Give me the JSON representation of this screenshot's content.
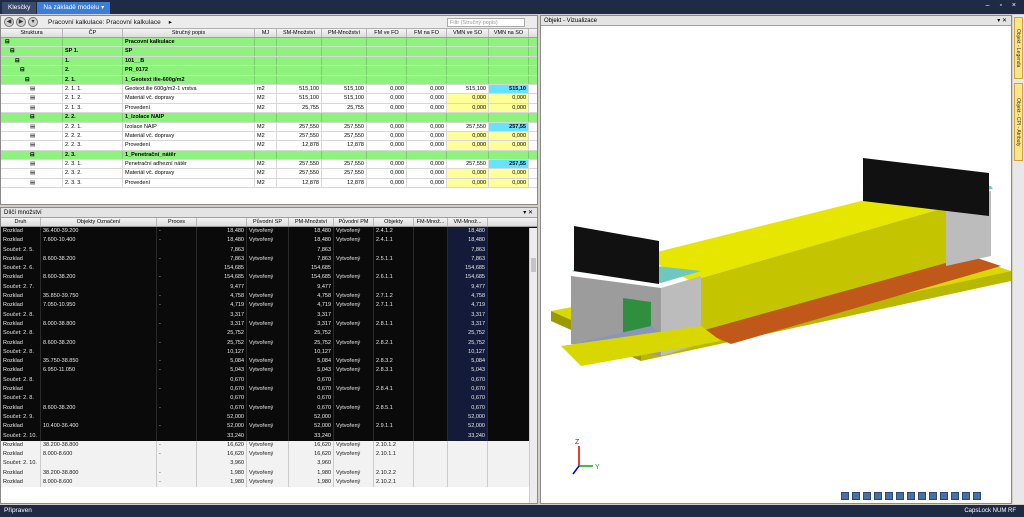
{
  "tabs": [
    {
      "label": "Klesčky"
    },
    {
      "label": "Na základě modelu"
    }
  ],
  "breadcrumb": "Pracovní kalkulace: Pracovní kalkulace",
  "filter_placeholder": "Filtr (Stručný popis)",
  "top_headers": [
    "Struktura",
    "ČP",
    "Stručný popis",
    "MJ",
    "SM-Množství",
    "PM-Množství",
    "FM ve FO",
    "FM na FO",
    "VMN ve SO",
    "VMN na SO"
  ],
  "top_rows": [
    {
      "cp": "",
      "desc": "Pracovní kalkulace",
      "mj": "",
      "sm": "",
      "pm": "",
      "fm1": "",
      "fm2": "",
      "v1": "",
      "v2": "",
      "g": true
    },
    {
      "cp": "SP  1.",
      "desc": "SP",
      "mj": "",
      "sm": "",
      "pm": "",
      "fm1": "",
      "fm2": "",
      "v1": "",
      "v2": "",
      "g": true
    },
    {
      "cp": "1.",
      "desc": "101__B",
      "mj": "",
      "sm": "",
      "pm": "",
      "fm1": "",
      "fm2": "",
      "v1": "",
      "v2": "",
      "g": true
    },
    {
      "cp": "2.",
      "desc": "PR_0172",
      "mj": "",
      "sm": "",
      "pm": "",
      "fm1": "",
      "fm2": "",
      "v1": "",
      "v2": "",
      "g": true
    },
    {
      "cp": "2.  1.",
      "desc": "1_Geotext ilie-600g/m2",
      "mj": "",
      "sm": "",
      "pm": "",
      "fm1": "",
      "fm2": "",
      "v1": "",
      "v2": "",
      "g": true
    },
    {
      "cp": "2.  1.  1.",
      "desc": "Geotext.ilie 600g/m2-1 vrstva",
      "mj": "m2",
      "sm": "515,100",
      "pm": "515,100",
      "fm1": "0,000",
      "fm2": "0,000",
      "v1": "515,100",
      "v2": "515,10"
    },
    {
      "cp": "2.  1.  2.",
      "desc": "Materiál vč. dopravy",
      "mj": "M2",
      "sm": "515,100",
      "pm": "515,100",
      "fm1": "0,000",
      "fm2": "0,000",
      "v1": "0,000",
      "v2": "0,000"
    },
    {
      "cp": "2.  1.  3.",
      "desc": "Provedení",
      "mj": "M2",
      "sm": "25,755",
      "pm": "25,755",
      "fm1": "0,000",
      "fm2": "0,000",
      "v1": "0,000",
      "v2": "0,000"
    },
    {
      "cp": "2.  2.",
      "desc": "1_Izolace NAIP",
      "mj": "",
      "sm": "",
      "pm": "",
      "fm1": "",
      "fm2": "",
      "v1": "",
      "v2": "",
      "g": true
    },
    {
      "cp": "2.  2.  1.",
      "desc": "Izolace NAIP",
      "mj": "M2",
      "sm": "257,550",
      "pm": "257,550",
      "fm1": "0,000",
      "fm2": "0,000",
      "v1": "257,550",
      "v2": "257,55"
    },
    {
      "cp": "2.  2.  2.",
      "desc": "Materiál vč. dopravy",
      "mj": "M2",
      "sm": "257,550",
      "pm": "257,550",
      "fm1": "0,000",
      "fm2": "0,000",
      "v1": "0,000",
      "v2": "0,000"
    },
    {
      "cp": "2.  2.  3.",
      "desc": "Provedení",
      "mj": "M2",
      "sm": "12,878",
      "pm": "12,878",
      "fm1": "0,000",
      "fm2": "0,000",
      "v1": "0,000",
      "v2": "0,000"
    },
    {
      "cp": "2.  3.",
      "desc": "1_Penetrační_nátěr",
      "mj": "",
      "sm": "",
      "pm": "",
      "fm1": "",
      "fm2": "",
      "v1": "",
      "v2": "",
      "g": true
    },
    {
      "cp": "2.  3.  1.",
      "desc": "Penetrační adhezní nátěr",
      "mj": "M2",
      "sm": "257,550",
      "pm": "257,550",
      "fm1": "0,000",
      "fm2": "0,000",
      "v1": "257,550",
      "v2": "257,55"
    },
    {
      "cp": "2.  3.  2.",
      "desc": "Materiál vč. dopravy",
      "mj": "M2",
      "sm": "257,550",
      "pm": "257,550",
      "fm1": "0,000",
      "fm2": "0,000",
      "v1": "0,000",
      "v2": "0,000"
    },
    {
      "cp": "2.  3.  3.",
      "desc": "Provedení",
      "mj": "M2",
      "sm": "12,878",
      "pm": "12,878",
      "fm1": "0,000",
      "fm2": "0,000",
      "v1": "0,000",
      "v2": "0,000"
    }
  ],
  "bottom_title": "Dílčí množství",
  "bottom_headers": [
    "Druh",
    "Objekty Označení",
    "Proces",
    "",
    "Původní SP",
    "PM-Množství",
    "Původní PM",
    "Objekty",
    "FM-Množ...",
    "VM-Množ..."
  ],
  "bottom_rows": [
    [
      "Rozklad",
      "36.400-39.200",
      "-",
      "18,480",
      "Vytvořený",
      "18,480",
      "Vytvořený",
      "2.4.1.2",
      "",
      "18,480"
    ],
    [
      "Rozklad",
      "7.600-10.400",
      "-",
      "18,480",
      "Vytvořený",
      "18,480",
      "Vytvořený",
      "2.4.1.1",
      "",
      "18,480"
    ],
    [
      "Součet:  2.  5.",
      "",
      "",
      "7,863",
      "",
      "7,863",
      "",
      "",
      "",
      "7,863"
    ],
    [
      "Rozklad",
      "8.600-38.200",
      "-",
      "7,863",
      "Vytvořený",
      "7,863",
      "Vytvořený",
      "2.5.1.1",
      "",
      "7,863"
    ],
    [
      "Součet:  2.  6.",
      "",
      "",
      "154,685",
      "",
      "154,685",
      "",
      "",
      "",
      "154,685"
    ],
    [
      "Rozklad",
      "8.600-38.200",
      "-",
      "154,685",
      "Vytvořený",
      "154,685",
      "Vytvořený",
      "2.6.1.1",
      "",
      "154,685"
    ],
    [
      "Součet:  2.  7.",
      "",
      "",
      "9,477",
      "",
      "9,477",
      "",
      "",
      "",
      "9,477"
    ],
    [
      "Rozklad",
      "35.850-39.750",
      "-",
      "4,758",
      "Vytvořený",
      "4,758",
      "Vytvořený",
      "2.7.1.2",
      "",
      "4,758"
    ],
    [
      "Rozklad",
      "7.050-10.950",
      "-",
      "4,719",
      "Vytvořený",
      "4,719",
      "Vytvořený",
      "2.7.1.1",
      "",
      "4,719"
    ],
    [
      "Součet:  2.  8.",
      "",
      "",
      "3,317",
      "",
      "3,317",
      "",
      "",
      "",
      "3,317"
    ],
    [
      "Rozklad",
      "8.000-38.800",
      "-",
      "3,317",
      "Vytvořený",
      "3,317",
      "Vytvořený",
      "2.8.1.1",
      "",
      "3,317"
    ],
    [
      "Součet:  2.  8.",
      "",
      "",
      "25,752",
      "",
      "25,752",
      "",
      "",
      "",
      "25,752"
    ],
    [
      "Rozklad",
      "8.600-38.200",
      "-",
      "25,752",
      "Vytvořený",
      "25,752",
      "Vytvořený",
      "2.8.2.1",
      "",
      "25,752"
    ],
    [
      "Součet:  2.  8.",
      "",
      "",
      "10,127",
      "",
      "10,127",
      "",
      "",
      "",
      "10,127"
    ],
    [
      "Rozklad",
      "35.750-38.850",
      "-",
      "5,084",
      "Vytvořený",
      "5,084",
      "Vytvořený",
      "2.8.3.2",
      "",
      "5,084"
    ],
    [
      "Rozklad",
      "6.950-11.050",
      "-",
      "5,043",
      "Vytvořený",
      "5,043",
      "Vytvořený",
      "2.8.3.1",
      "",
      "5,043"
    ],
    [
      "Součet:  2.  8.",
      "",
      "",
      "0,670",
      "",
      "0,670",
      "",
      "",
      "",
      "0,670"
    ],
    [
      "Rozklad",
      "",
      "-",
      "0,670",
      "Vytvořený",
      "0,670",
      "Vytvořený",
      "2.8.4.1",
      "",
      "0,670"
    ],
    [
      "Součet:  2.  8.",
      "",
      "",
      "0,670",
      "",
      "0,670",
      "",
      "",
      "",
      "0,670"
    ],
    [
      "Rozklad",
      "8.600-38.200",
      "-",
      "0,670",
      "Vytvořený",
      "0,670",
      "Vytvořený",
      "2.8.5.1",
      "",
      "0,670"
    ],
    [
      "Součet:  2.  9.",
      "",
      "",
      "52,000",
      "",
      "52,000",
      "",
      "",
      "",
      "52,000"
    ],
    [
      "Rozklad",
      "10.400-36.400",
      "-",
      "52,000",
      "Vytvořený",
      "52,000",
      "Vytvořený",
      "2.9.1.1",
      "",
      "52,000"
    ],
    [
      "Součet:  2.  10.",
      "",
      "",
      "33,240",
      "",
      "33,240",
      "",
      "",
      "",
      "33,240"
    ],
    [
      "Rozklad",
      "38.200-38.800",
      "-",
      "16,620",
      "Vytvořený",
      "16,620",
      "Vytvořený",
      "2.10.1.2",
      "",
      ""
    ],
    [
      "Rozklad",
      "8.000-8.600",
      "-",
      "16,620",
      "Vytvořený",
      "16,620",
      "Vytvořený",
      "2.10.1.1",
      "",
      ""
    ],
    [
      "Součet:  2.  10.",
      "",
      "",
      "3,960",
      "",
      "3,960",
      "",
      "",
      "",
      ""
    ],
    [
      "Rozklad",
      "38.200-38.800",
      "-",
      "1,980",
      "Vytvořený",
      "1,980",
      "Vytvořený",
      "2.10.2.2",
      "",
      ""
    ],
    [
      "Rozklad",
      "8.000-8.600",
      "-",
      "1,980",
      "Vytvořený",
      "1,980",
      "Vytvořený",
      "2.10.2.1",
      "",
      ""
    ]
  ],
  "viewer_title": "Objekt - Vizualizace",
  "side_tabs": [
    "Objekt - Legenda",
    "Objekt - CPI - Atributy"
  ],
  "status": "Připraven",
  "status_right": "CapsLock  NUM  RF",
  "colors": {
    "green": "#8ef37c",
    "yellow": "#ffff99",
    "cyan": "#66e3ff",
    "dark": "#0a0a0a"
  }
}
